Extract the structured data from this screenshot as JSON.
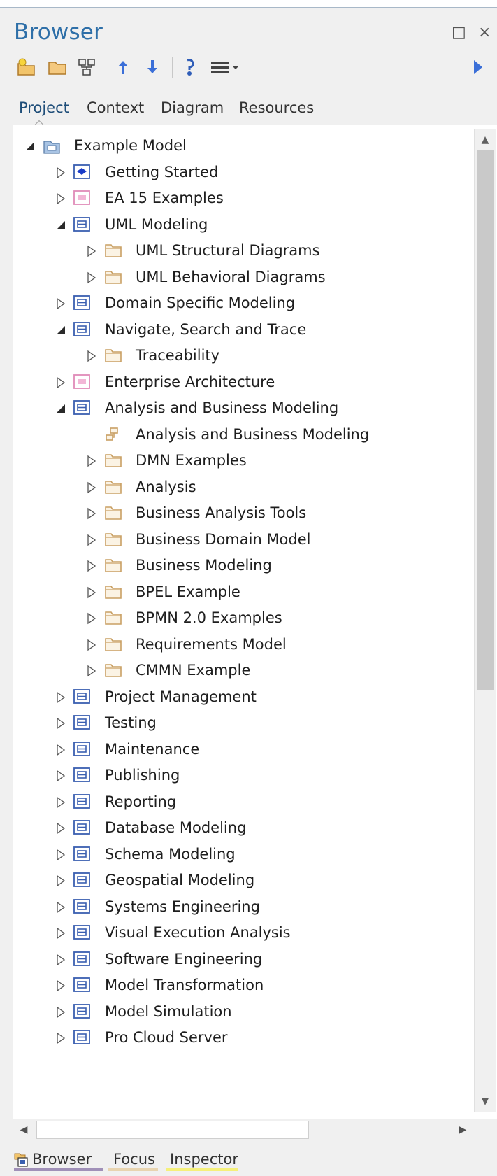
{
  "window": {
    "title": "Browser",
    "maximize_glyph": "□",
    "close_glyph": "×"
  },
  "toolbar": {
    "buttons": [
      "new-package-icon",
      "open-folder-icon",
      "hierarchy-icon",
      "move-up-icon",
      "move-down-icon",
      "locate-icon",
      "menu-icon",
      "dropdown-caret-icon",
      "forward-arrow-icon"
    ]
  },
  "tabs": {
    "project": "Project",
    "context": "Context",
    "diagram": "Diagram",
    "resources": "Resources",
    "active": "Project"
  },
  "tree": {
    "items": [
      {
        "label": "Example Model",
        "level": 0,
        "state": "expanded",
        "icon": "model-root-icon"
      },
      {
        "label": "Getting Started",
        "level": 1,
        "state": "collapsed",
        "icon": "blue-diamond-package-icon"
      },
      {
        "label": "EA 15 Examples",
        "level": 1,
        "state": "collapsed",
        "icon": "pink-package-icon"
      },
      {
        "label": "UML Modeling",
        "level": 1,
        "state": "expanded",
        "icon": "blue-package-icon"
      },
      {
        "label": "UML Structural Diagrams",
        "level": 2,
        "state": "collapsed",
        "icon": "folder-icon"
      },
      {
        "label": "UML Behavioral Diagrams",
        "level": 2,
        "state": "collapsed",
        "icon": "folder-icon"
      },
      {
        "label": "Domain Specific Modeling",
        "level": 1,
        "state": "collapsed",
        "icon": "blue-package-icon"
      },
      {
        "label": "Navigate, Search and Trace",
        "level": 1,
        "state": "expanded",
        "icon": "blue-package-icon"
      },
      {
        "label": "Traceability",
        "level": 2,
        "state": "collapsed",
        "icon": "folder-icon"
      },
      {
        "label": "Enterprise Architecture",
        "level": 1,
        "state": "collapsed",
        "icon": "pink-package-icon"
      },
      {
        "label": "Analysis and Business Modeling",
        "level": 1,
        "state": "expanded",
        "icon": "blue-package-icon"
      },
      {
        "label": "Analysis and Business Modeling",
        "level": 2,
        "state": "none",
        "icon": "diagram-icon"
      },
      {
        "label": "DMN Examples",
        "level": 2,
        "state": "collapsed",
        "icon": "folder-icon"
      },
      {
        "label": "Analysis",
        "level": 2,
        "state": "collapsed",
        "icon": "folder-icon"
      },
      {
        "label": "Business Analysis Tools",
        "level": 2,
        "state": "collapsed",
        "icon": "folder-icon"
      },
      {
        "label": "Business Domain Model",
        "level": 2,
        "state": "collapsed",
        "icon": "folder-icon"
      },
      {
        "label": "Business Modeling",
        "level": 2,
        "state": "collapsed",
        "icon": "folder-icon"
      },
      {
        "label": "BPEL Example",
        "level": 2,
        "state": "collapsed",
        "icon": "folder-icon"
      },
      {
        "label": "BPMN 2.0 Examples",
        "level": 2,
        "state": "collapsed",
        "icon": "folder-icon"
      },
      {
        "label": "Requirements Model",
        "level": 2,
        "state": "collapsed",
        "icon": "folder-icon"
      },
      {
        "label": "CMMN Example",
        "level": 2,
        "state": "collapsed",
        "icon": "folder-icon"
      },
      {
        "label": "Project Management",
        "level": 1,
        "state": "collapsed",
        "icon": "blue-package-icon"
      },
      {
        "label": "Testing",
        "level": 1,
        "state": "collapsed",
        "icon": "blue-package-icon"
      },
      {
        "label": "Maintenance",
        "level": 1,
        "state": "collapsed",
        "icon": "blue-package-icon"
      },
      {
        "label": "Publishing",
        "level": 1,
        "state": "collapsed",
        "icon": "blue-package-icon"
      },
      {
        "label": "Reporting",
        "level": 1,
        "state": "collapsed",
        "icon": "blue-package-icon"
      },
      {
        "label": "Database Modeling",
        "level": 1,
        "state": "collapsed",
        "icon": "blue-package-icon"
      },
      {
        "label": "Schema Modeling",
        "level": 1,
        "state": "collapsed",
        "icon": "blue-package-icon"
      },
      {
        "label": "Geospatial Modeling",
        "level": 1,
        "state": "collapsed",
        "icon": "blue-package-icon"
      },
      {
        "label": "Systems Engineering",
        "level": 1,
        "state": "collapsed",
        "icon": "blue-package-icon"
      },
      {
        "label": "Visual Execution Analysis",
        "level": 1,
        "state": "collapsed",
        "icon": "blue-package-icon"
      },
      {
        "label": "Software Engineering",
        "level": 1,
        "state": "collapsed",
        "icon": "blue-package-icon"
      },
      {
        "label": "Model Transformation",
        "level": 1,
        "state": "collapsed",
        "icon": "blue-package-icon"
      },
      {
        "label": "Model Simulation",
        "level": 1,
        "state": "collapsed",
        "icon": "blue-package-icon"
      },
      {
        "label": "Pro Cloud Server",
        "level": 1,
        "state": "collapsed",
        "icon": "blue-package-icon"
      }
    ]
  },
  "bottom_tabs": {
    "browser": "Browser",
    "focus": "Focus",
    "inspector": "Inspector",
    "active": "Browser"
  },
  "colors": {
    "title": "#2e6fa8",
    "package_blue": "#3a5fb0",
    "package_pink": "#e79ac8",
    "folder": "#c9a064",
    "focus_underline": "#e8d4b0",
    "inspector_underline": "#f5f07a",
    "browser_underline": "#a090b8"
  }
}
